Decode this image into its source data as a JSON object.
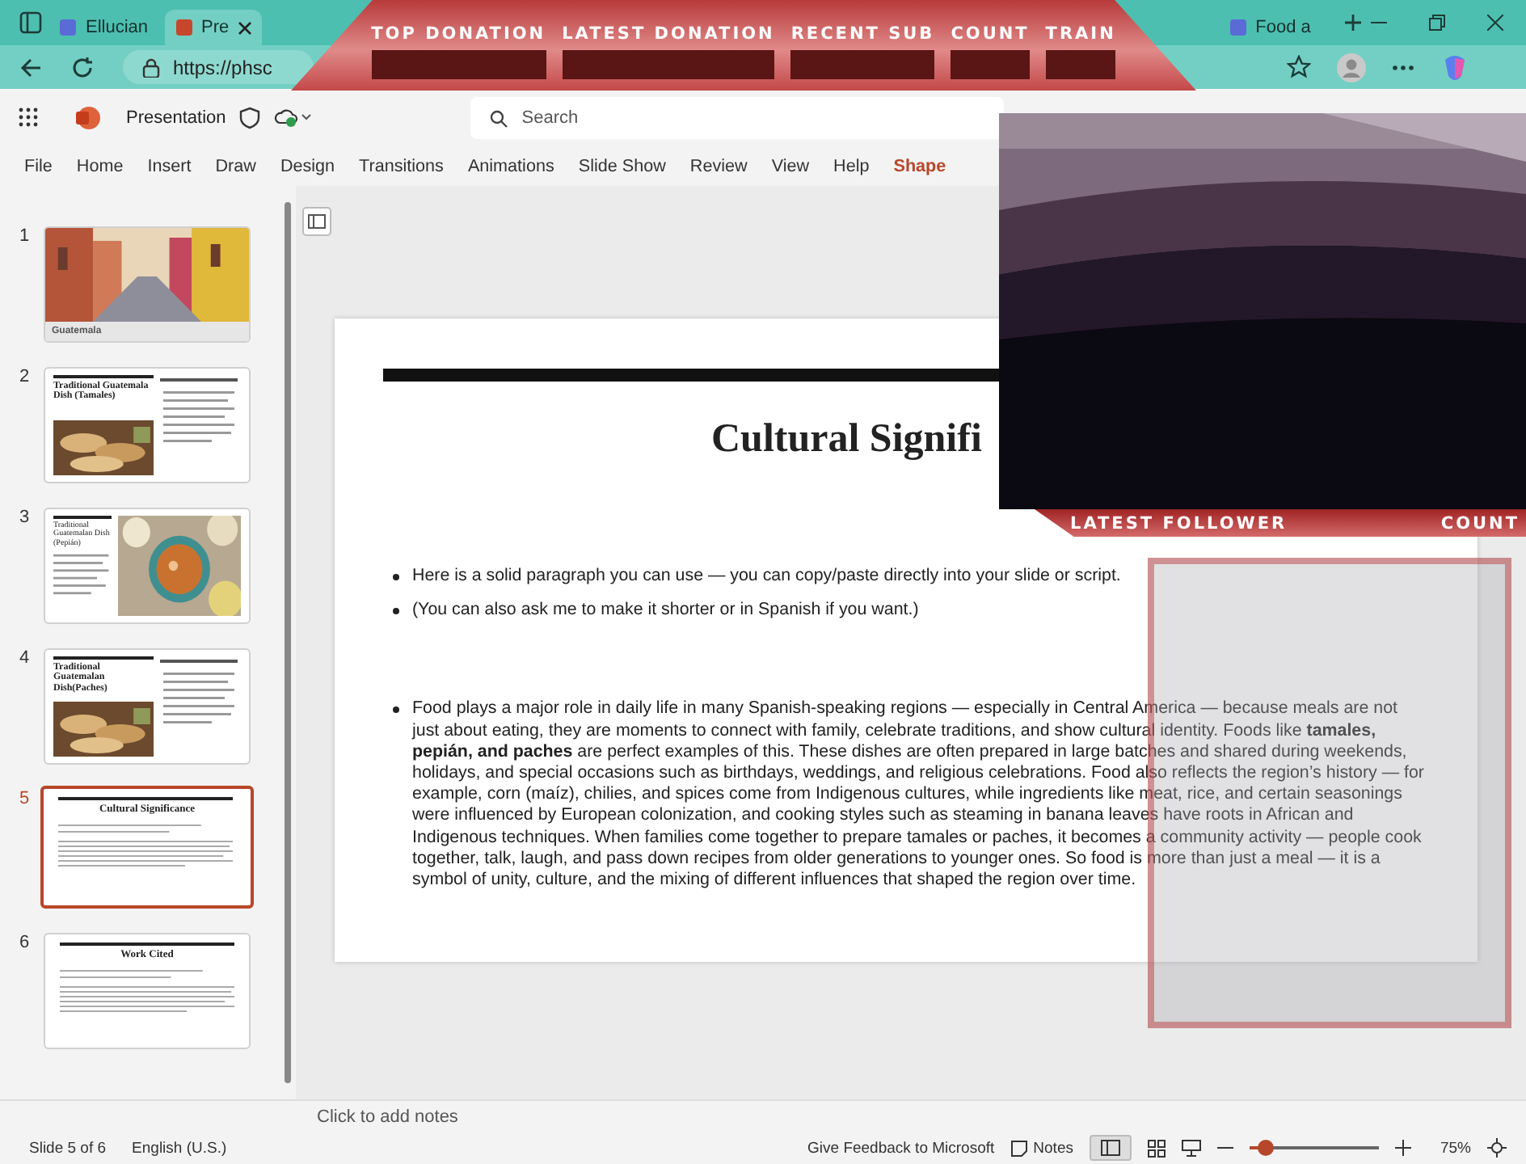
{
  "browser": {
    "tabs": [
      {
        "title": "Ellucian",
        "selected": false
      },
      {
        "title": "Pre",
        "selected": true
      },
      {
        "title": "Food a",
        "selected": false
      }
    ],
    "url": "https://phsc"
  },
  "stream_overlay": {
    "top_labels": [
      "TOP DONATION",
      "LATEST DONATION",
      "RECENT SUB",
      "COUNT",
      "TRAIN"
    ],
    "bottom_labels": [
      "LATEST FOLLOWER",
      "COUNT"
    ]
  },
  "app": {
    "title": "Presentation",
    "search": {
      "placeholder": "Search"
    }
  },
  "ribbon": {
    "tabs": [
      {
        "label": "File",
        "selected": false
      },
      {
        "label": "Home",
        "selected": false
      },
      {
        "label": "Insert",
        "selected": false
      },
      {
        "label": "Draw",
        "selected": false
      },
      {
        "label": "Design",
        "selected": false
      },
      {
        "label": "Transitions",
        "selected": false
      },
      {
        "label": "Animations",
        "selected": false
      },
      {
        "label": "Slide Show",
        "selected": false
      },
      {
        "label": "Review",
        "selected": false
      },
      {
        "label": "View",
        "selected": false
      },
      {
        "label": "Help",
        "selected": false
      },
      {
        "label": "Shape",
        "selected": true
      }
    ]
  },
  "slides_panel": {
    "slides": [
      {
        "number": "1",
        "title": "Guatemala",
        "kind": "cover",
        "selected": false
      },
      {
        "number": "2",
        "title": "Traditional Guatemala Dish (Tamales)",
        "kind": "image-left",
        "selected": false
      },
      {
        "number": "3",
        "title": "Traditional Guatemalan Dish (Pepián)",
        "kind": "image-right",
        "selected": false
      },
      {
        "number": "4",
        "title": "Traditional Guatemalan Dish(Paches)",
        "kind": "image-left",
        "selected": false
      },
      {
        "number": "5",
        "title": "Cultural Significance",
        "kind": "text",
        "selected": true
      },
      {
        "number": "6",
        "title": "Work Cited",
        "kind": "text",
        "selected": false
      }
    ]
  },
  "slide": {
    "title": "Cultural Signifi",
    "bullets": [
      "Here is a solid paragraph you can use — you can copy/paste directly into your slide or script.",
      "(You can also ask me to make it shorter or in Spanish if you want.)",
      "Food plays a major role in daily life in many Spanish-speaking regions — especially in Central America — because meals are not just about eating, they are moments to connect with family, celebrate traditions, and show cultural identity. Foods like **tamales, pepián, and paches** are perfect examples of this. These dishes are often prepared in large batches and shared during weekends, holidays, and special occasions such as birthdays, weddings, and religious celebrations. Food also reflects the region’s history — for example, corn (maíz), chilies, and spices come from Indigenous cultures, while ingredients like meat, rice, and certain seasonings were influenced by European colonization, and cooking styles such as steaming in banana leaves have roots in African and Indigenous techniques. When families come together to prepare tamales or paches, it becomes a community activity — people cook together, talk, laugh, and pass down recipes from older generations to younger ones. So food is more than just a meal — it is a symbol of unity, culture, and the mixing of different influences that shaped the region over time."
    ]
  },
  "notes": {
    "placeholder": "Click to add notes"
  },
  "status_bar": {
    "slide_info": "Slide 5 of 6",
    "language": "English (U.S.)",
    "feedback": "Give Feedback to Microsoft",
    "notes": "Notes",
    "zoom": {
      "level": 0.12,
      "reading": "75%"
    }
  }
}
